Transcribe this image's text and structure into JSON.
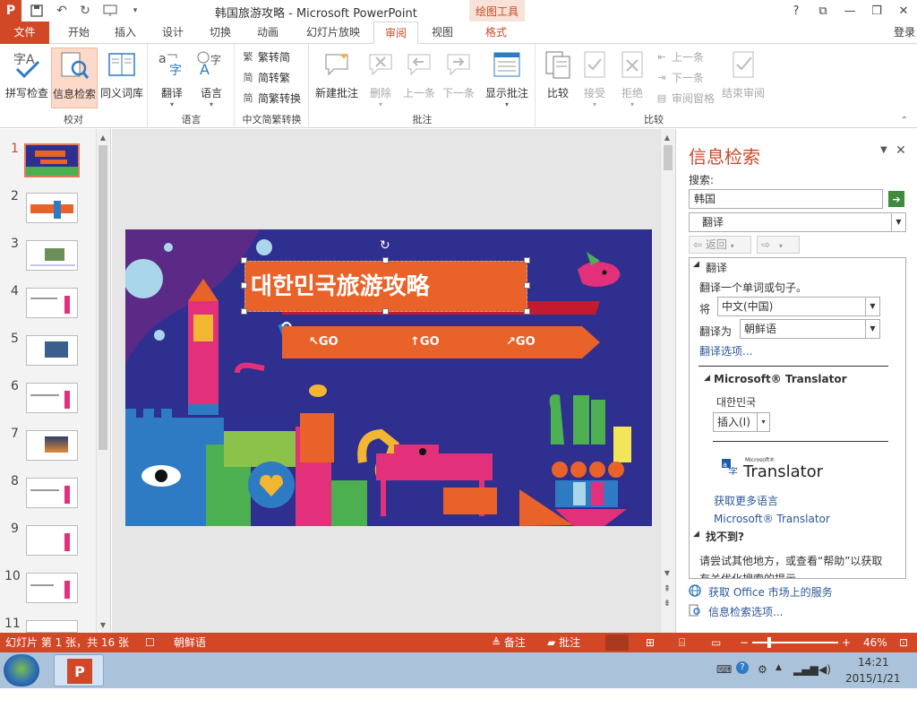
{
  "window": {
    "title": "韩国旅游攻略 - Microsoft PowerPoint",
    "context_tab_group": "绘图工具",
    "controls": [
      "?",
      "⧉",
      "—",
      "❐",
      "✕"
    ]
  },
  "tabs": {
    "file": "文件",
    "items": [
      "开始",
      "插入",
      "设计",
      "切换",
      "动画",
      "幻灯片放映",
      "审阅",
      "视图",
      "格式"
    ],
    "active": "审阅",
    "login": "登录"
  },
  "ribbon": {
    "groups": {
      "proofing": {
        "label": "校对",
        "buttons": [
          "拼写检查",
          "信息检索",
          "同义词库"
        ]
      },
      "language": {
        "label": "语言",
        "buttons": [
          "翻译",
          "语言"
        ]
      },
      "chinese": {
        "label": "中文简繁转换",
        "buttons": [
          "繁转简",
          "简转繁",
          "简繁转换"
        ]
      },
      "comments": {
        "label": "批注",
        "buttons": [
          "新建批注",
          "删除",
          "上一条",
          "下一条",
          "显示批注"
        ]
      },
      "compare": {
        "label": "比较",
        "buttons": [
          "比较",
          "接受",
          "拒绝",
          "上一条",
          "下一条",
          "审阅窗格",
          "结束审阅"
        ]
      }
    }
  },
  "slides": {
    "numbers": [
      "1",
      "2",
      "3",
      "4",
      "5",
      "6",
      "7",
      "8",
      "9",
      "10",
      "11"
    ],
    "selected": "1"
  },
  "slide": {
    "title": "대한민국旅游攻略",
    "buttons": [
      "↖GO",
      "↑GO",
      "↗GO"
    ]
  },
  "research_pane": {
    "title": "信息检索",
    "search_label": "搜索:",
    "search_value": "韩国",
    "service": "翻译",
    "back": "返回",
    "section_translate": "翻译",
    "translate_hint": "翻译一个单词或句子。",
    "from_label": "将",
    "from_value": "中文(中国)",
    "to_label": "翻译为",
    "to_value": "朝鲜语",
    "options_link": "翻译选项...",
    "translator_header": "Microsoft® Translator",
    "result": "대한민국",
    "insert": "插入(I)",
    "logo_small": "Microsoft®",
    "logo_big": "Translator",
    "more_languages": "获取更多语言",
    "translator_link": "Microsoft® Translator",
    "not_found": "找不到?",
    "not_found_text": "请尝试其他地方，或查看“帮助”以获取有关优化搜索的提示",
    "office_market": "获取 Office 市场上的服务",
    "research_options": "信息检索选项..."
  },
  "status": {
    "slide_info": "幻灯片 第 1 张，共 16 张",
    "language": "朝鲜语",
    "notes": "备注",
    "comments": "批注",
    "zoom": "46%"
  },
  "taskbar": {
    "time": "14:21",
    "date": "2015/1/21"
  },
  "colors": {
    "accent": "#d24726",
    "slide_bg": "#2f2f8f",
    "slide_orange": "#e8622a"
  }
}
